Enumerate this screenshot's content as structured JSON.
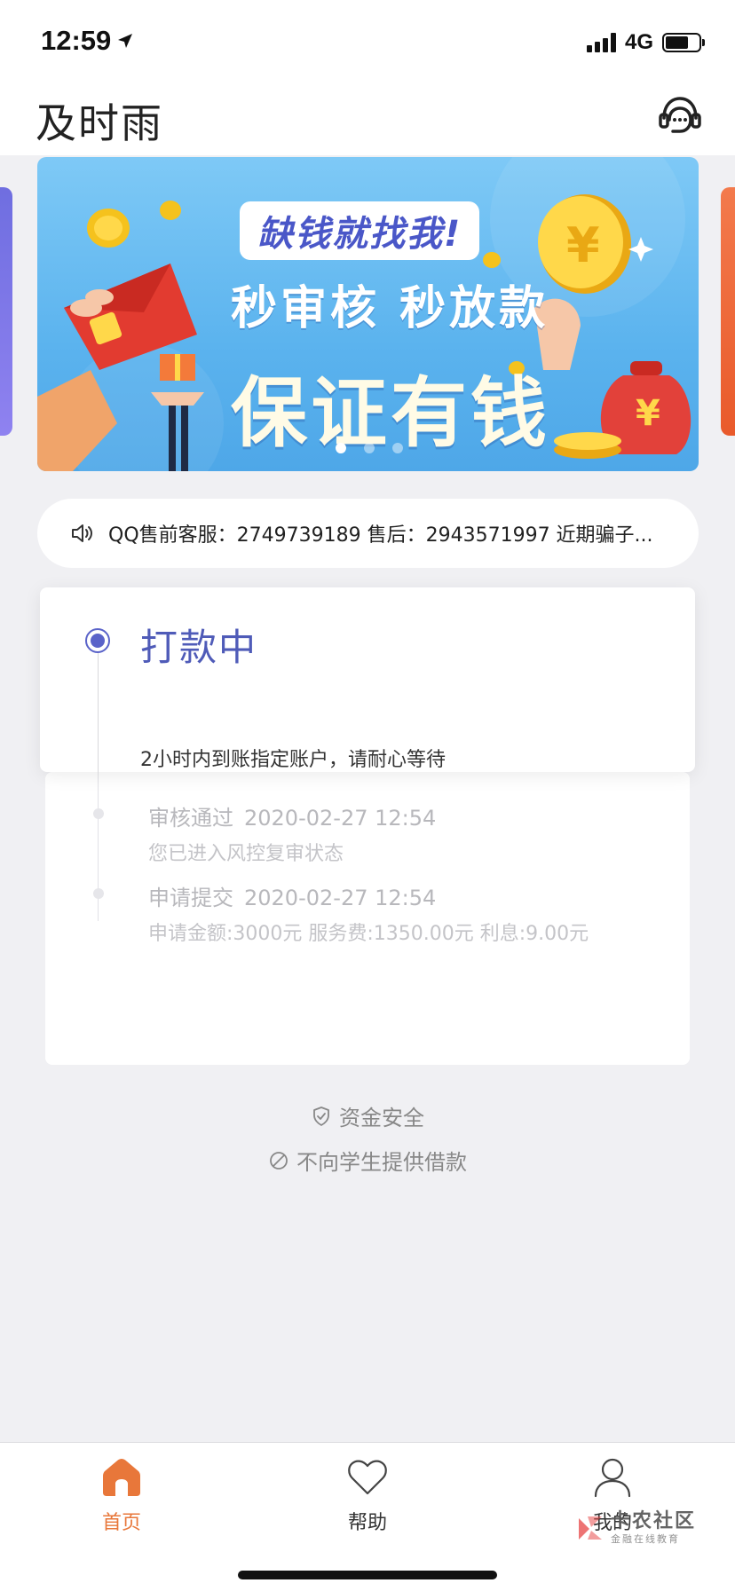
{
  "status_bar": {
    "time": "12:59",
    "network": "4G",
    "battery_level": 0.7
  },
  "header": {
    "title": "及时雨",
    "service_icon": "customer-service-headset-icon"
  },
  "banner": {
    "tag": "缺钱就找我!",
    "line1": "秒审核 秒放款",
    "line2": "保证有钱",
    "slide_count": 3,
    "active_slide": 1,
    "colors": {
      "background": "#5bb3ee",
      "tag_text": "#4a57c8"
    }
  },
  "notice": {
    "icon": "speaker-icon",
    "text": "QQ售前客服：2749739189 售后：2943571997 近期骗子..."
  },
  "loan_status": {
    "current_step": {
      "title": "打款中",
      "description": "2小时内到账指定账户，请耐心等待"
    },
    "history": [
      {
        "title": "审核通过",
        "time": "2020-02-27 12:54",
        "description": "您已进入风控复审状态"
      },
      {
        "title": "申请提交",
        "time": "2020-02-27 12:54",
        "description": "申请金额:3000元  服务费:1350.00元 利息:9.00元"
      }
    ],
    "colors": {
      "accent": "#5a63c9"
    }
  },
  "safety_notes": [
    {
      "icon": "shield-check-icon",
      "text": "资金安全"
    },
    {
      "icon": "prohibited-icon",
      "text": "不向学生提供借款"
    }
  ],
  "tab_bar": {
    "items": [
      {
        "label": "首页",
        "icon": "home-icon",
        "active": true
      },
      {
        "label": "帮助",
        "icon": "heart-icon",
        "active": false
      },
      {
        "label": "我的",
        "icon": "user-icon",
        "active": false
      }
    ],
    "active_color": "#e8773a"
  },
  "watermark": {
    "main": "卡农社区",
    "sub": "金融在线教育"
  }
}
